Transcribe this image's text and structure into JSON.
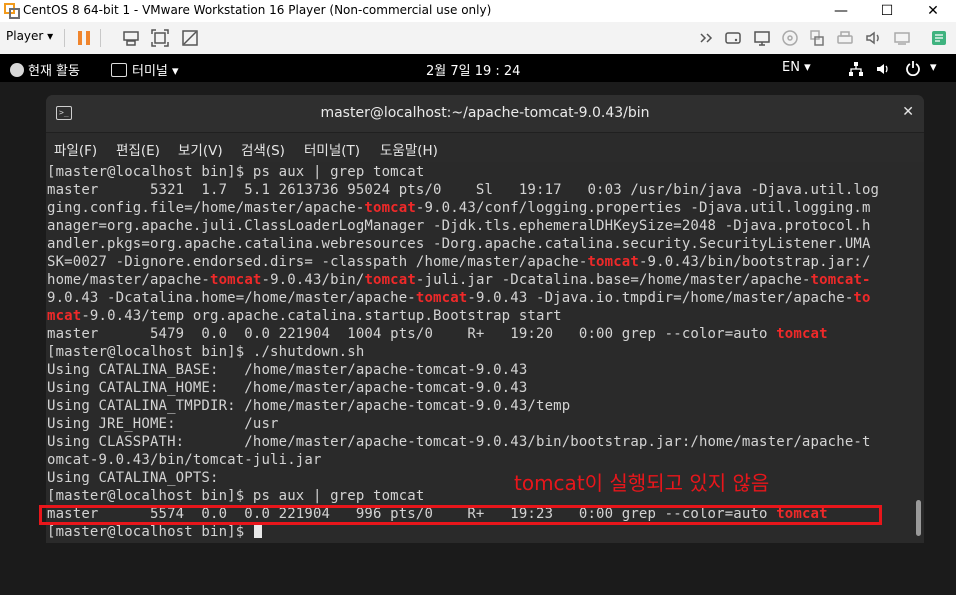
{
  "vm_window": {
    "title": "CentOS 8 64-bit 1 - VMware Workstation 16 Player (Non-commercial use only)",
    "controls": {
      "minimize": "—",
      "maximize": "☐",
      "close": "✕"
    },
    "colors": {
      "accent": "#f29b1d"
    }
  },
  "toolbar": {
    "player_menu": "Player",
    "icons": [
      "pause-icon",
      "send-ctrl-alt-del-icon",
      "fit-guest-icon",
      "unity-icon",
      "forward-icon",
      "hdd-icon",
      "network-icon",
      "cd-icon",
      "usb-icon",
      "printer-icon",
      "sound-icon",
      "display-icon",
      "notes-icon"
    ]
  },
  "gnome": {
    "activities": "현재 활동",
    "terminal_app": "터미널",
    "clock": "2월 7일  19 : 24",
    "language": "EN"
  },
  "terminal": {
    "title": "master@localhost:~/apache-tomcat-9.0.43/bin",
    "menu": [
      "파일(F)",
      "편집(E)",
      "보기(V)",
      "검색(S)",
      "터미널(T)",
      "도움말(H)"
    ],
    "lines": [
      [
        {
          "t": "[master@localhost bin]$ ps aux | grep tomcat"
        }
      ],
      [
        {
          "t": "master      5321  1.7  5.1 2613736 95024 pts/0    Sl   19:17   0:03 /usr/bin/java -Djava.util.log"
        }
      ],
      [
        {
          "t": "ging.config.file=/home/master/apache-"
        },
        {
          "t": "tomcat",
          "red": true
        },
        {
          "t": "-9.0.43/conf/logging.properties -Djava.util.logging.m"
        }
      ],
      [
        {
          "t": "anager=org.apache.juli.ClassLoaderLogManager -Djdk.tls.ephemeralDHKeySize=2048 -Djava.protocol.h"
        }
      ],
      [
        {
          "t": "andler.pkgs=org.apache.catalina.webresources -Dorg.apache.catalina.security.SecurityListener.UMA"
        }
      ],
      [
        {
          "t": "SK=0027 -Dignore.endorsed.dirs= -classpath /home/master/apache-"
        },
        {
          "t": "tomcat",
          "red": true
        },
        {
          "t": "-9.0.43/bin/bootstrap.jar:/"
        }
      ],
      [
        {
          "t": "home/master/apache-"
        },
        {
          "t": "tomcat",
          "red": true
        },
        {
          "t": "-9.0.43/bin/"
        },
        {
          "t": "tomcat",
          "red": true
        },
        {
          "t": "-juli.jar -Dcatalina.base=/home/master/apache-"
        },
        {
          "t": "tomcat-",
          "red": true
        }
      ],
      [
        {
          "t": "9.0.43 -Dcatalina.home=/home/master/apache-"
        },
        {
          "t": "tomcat",
          "red": true
        },
        {
          "t": "-9.0.43 -Djava.io.tmpdir=/home/master/apache-"
        },
        {
          "t": "to",
          "red": true
        }
      ],
      [
        {
          "t": "mcat",
          "red": true
        },
        {
          "t": "-9.0.43/temp org.apache.catalina.startup.Bootstrap start"
        }
      ],
      [
        {
          "t": "master      5479  0.0  0.0 221904  1004 pts/0    R+   19:20   0:00 grep --color=auto "
        },
        {
          "t": "tomcat",
          "red": true
        }
      ],
      [
        {
          "t": "[master@localhost bin]$ ./shutdown.sh"
        }
      ],
      [
        {
          "t": "Using CATALINA_BASE:   /home/master/apache-tomcat-9.0.43"
        }
      ],
      [
        {
          "t": "Using CATALINA_HOME:   /home/master/apache-tomcat-9.0.43"
        }
      ],
      [
        {
          "t": "Using CATALINA_TMPDIR: /home/master/apache-tomcat-9.0.43/temp"
        }
      ],
      [
        {
          "t": "Using JRE_HOME:        /usr"
        }
      ],
      [
        {
          "t": "Using CLASSPATH:       /home/master/apache-tomcat-9.0.43/bin/bootstrap.jar:/home/master/apache-t"
        }
      ],
      [
        {
          "t": "omcat-9.0.43/bin/tomcat-juli.jar"
        }
      ],
      [
        {
          "t": "Using CATALINA_OPTS:"
        }
      ],
      [
        {
          "t": "[master@localhost bin]$ ps aux | grep tomcat"
        }
      ],
      [
        {
          "t": "master      5574  0.0  0.0 221904   996 pts/0    R+   19:23   0:00 grep --color=auto "
        },
        {
          "t": "tomcat",
          "red": true
        }
      ],
      [
        {
          "t": "[master@localhost bin]$ "
        },
        {
          "cursor": true
        }
      ]
    ],
    "colors": {
      "match": "#ef2929",
      "text": "#d3d3d3"
    }
  },
  "annotation": {
    "text": "tomcat이 실행되고 있지 않음",
    "color": "#e8161b"
  }
}
